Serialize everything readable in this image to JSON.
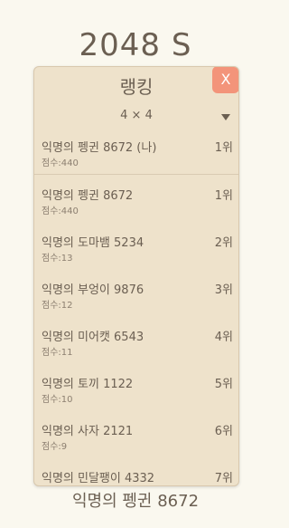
{
  "app_title": "2048 S",
  "ranking": {
    "title": "랭킹",
    "close_label": "X",
    "mode_value": "4 × 4",
    "my_entry": {
      "name": "익명의 펭귄 8672 (나)",
      "rank": "1위",
      "score": "점수:440"
    },
    "entries": [
      {
        "name": "익명의 펭귄 8672",
        "rank": "1위",
        "score": "점수:440"
      },
      {
        "name": "익명의 도마뱀 5234",
        "rank": "2위",
        "score": "점수:13"
      },
      {
        "name": "익명의 부엉이 9876",
        "rank": "3위",
        "score": "점수:12"
      },
      {
        "name": "익명의 미어캣 6543",
        "rank": "4위",
        "score": "점수:11"
      },
      {
        "name": "익명의 토끼 1122",
        "rank": "5위",
        "score": "점수:10"
      },
      {
        "name": "익명의 사자 2121",
        "rank": "6위",
        "score": "점수:9"
      },
      {
        "name": "익명의 민달팽이 4332",
        "rank": "7위",
        "score": ""
      }
    ]
  },
  "footer_name": "익명의 펭귄 8672"
}
